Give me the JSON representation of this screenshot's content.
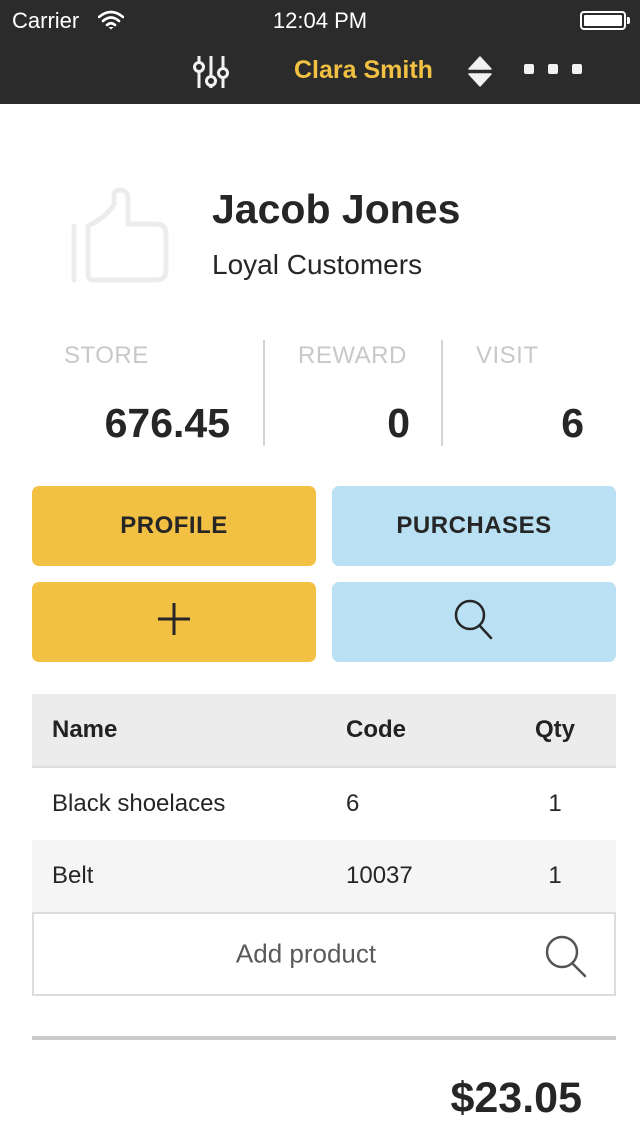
{
  "status_bar": {
    "carrier": "Carrier",
    "time": "12:04 PM",
    "icons": [
      "wifi-icon",
      "battery-icon"
    ]
  },
  "nav": {
    "filter_icon": "sliders-icon",
    "user_name": "Clara Smith",
    "sort_icon": "sort-updown-icon",
    "more_icon": "more-dots-icon"
  },
  "customer": {
    "icon": "thumbs-up-icon",
    "name": "Jacob Jones",
    "group": "Loyal Customers"
  },
  "stats": [
    {
      "label": "STORE",
      "value": "676.45"
    },
    {
      "label": "REWARD",
      "value": "0"
    },
    {
      "label": "VISIT",
      "value": "6"
    }
  ],
  "actions": {
    "profile_label": "PROFILE",
    "purchases_label": "PURCHASES",
    "add_icon": "plus-icon",
    "search_icon": "search-icon"
  },
  "table": {
    "headers": {
      "name": "Name",
      "code": "Code",
      "qty": "Qty"
    },
    "rows": [
      {
        "name": "Black shoelaces",
        "code": "6",
        "qty": "1"
      },
      {
        "name": "Belt",
        "code": "10037",
        "qty": "1"
      }
    ]
  },
  "add_product": {
    "placeholder": "Add product"
  },
  "total": "$23.05",
  "colors": {
    "topbar": "#2b2b2b",
    "accent_yellow": "#f2c043",
    "accent_blue": "#b9e1f3",
    "text_dark": "#262626",
    "label_gray": "#c8c8c8"
  }
}
